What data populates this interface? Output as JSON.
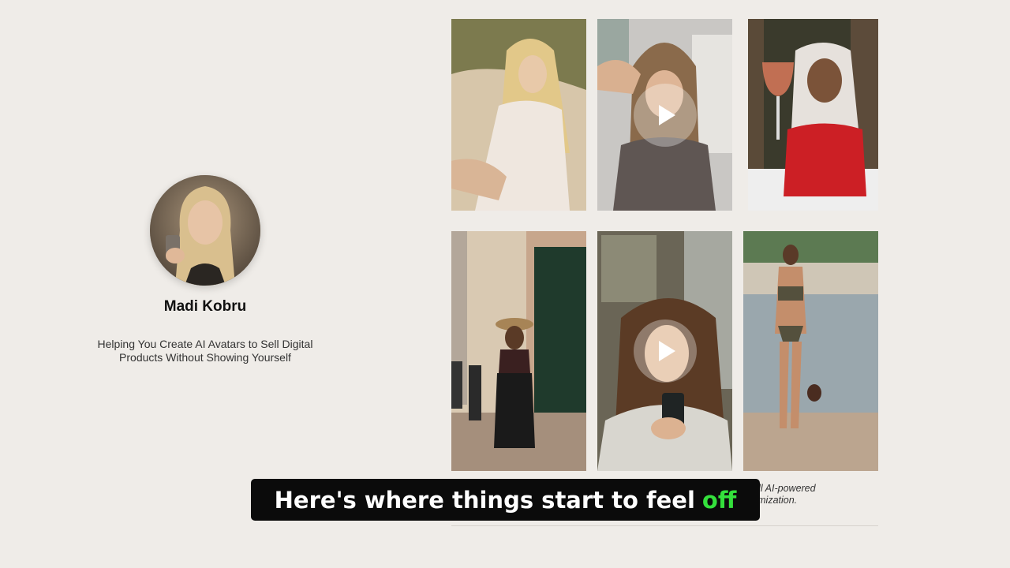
{
  "profile": {
    "name": "Madi Kobru",
    "tagline": "Helping You Create AI Avatars to Sell Digital Products Without Showing Yourself"
  },
  "gallery": {
    "tiles": [
      {
        "kind": "photo",
        "icon": "photo-beach-blonde"
      },
      {
        "kind": "video",
        "icon": "play-icon"
      },
      {
        "kind": "photo",
        "icon": "photo-wine-glass"
      },
      {
        "kind": "photo",
        "icon": "photo-street-walk"
      },
      {
        "kind": "video",
        "icon": "play-icon"
      },
      {
        "kind": "photo",
        "icon": "photo-beach-bikini"
      }
    ],
    "caption_line1": "ey are still AI-powered",
    "caption_line2": "d customization."
  },
  "subtitle": {
    "text": "Here's where things start to feel",
    "highlight": "off",
    "highlight_color": "#34e03c"
  },
  "colors": {
    "background": "#efece8",
    "subtitle_bg": "#0b0b0b"
  }
}
